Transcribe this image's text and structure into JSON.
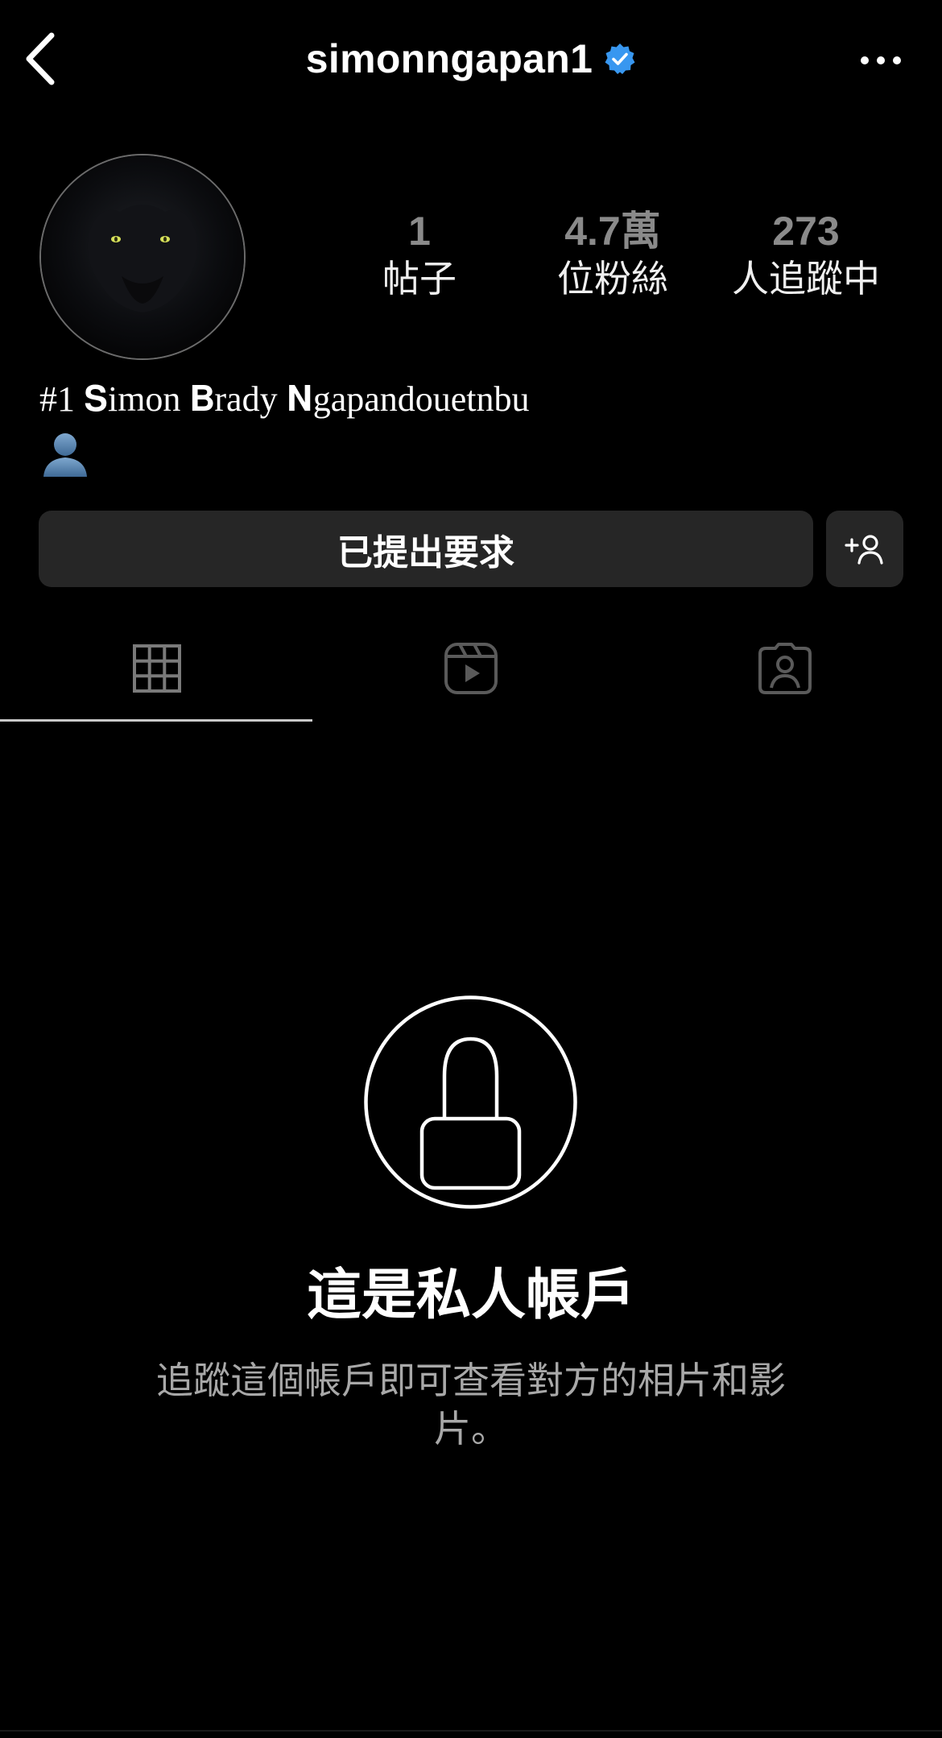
{
  "header": {
    "username": "simonngapan1",
    "verified_color": "#3897f0"
  },
  "stats": [
    {
      "value": "1",
      "label": "帖子"
    },
    {
      "value": "4.7萬",
      "label": "位粉絲"
    },
    {
      "value": "273",
      "label": "人追蹤中"
    }
  ],
  "bio": {
    "name": "#1 𝐒imon 𝐁rady 𝐍gapandouetnbu",
    "emoji": "👤"
  },
  "actions": {
    "requested_label": "已提出要求"
  },
  "tabs": [
    {
      "icon": "grid-icon",
      "active": true
    },
    {
      "icon": "reels-icon",
      "active": false
    },
    {
      "icon": "tagged-icon",
      "active": false
    }
  ],
  "private": {
    "title": "這是私人帳戶",
    "description": "追蹤這個帳戶即可查看對方的相片和影片。"
  },
  "colors": {
    "background": "#000000",
    "button_bg": "#262626",
    "muted_text": "#a8a8a8"
  }
}
